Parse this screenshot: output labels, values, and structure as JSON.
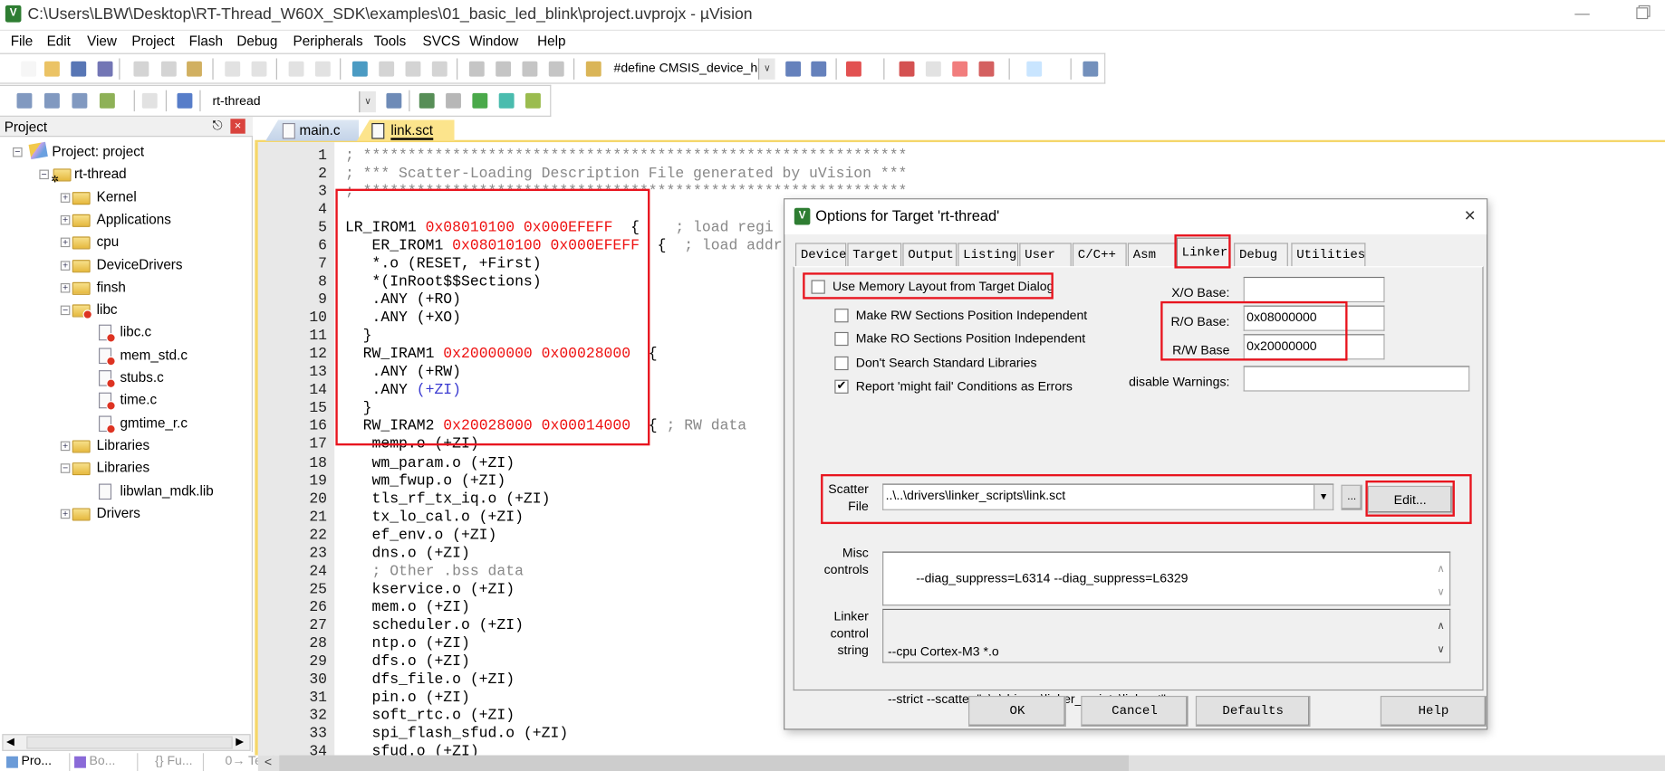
{
  "window": {
    "title": "C:\\Users\\LBW\\Desktop\\RT-Thread_W60X_SDK\\examples\\01_basic_led_blink\\project.uvprojx - µVision",
    "app_icon": "uvision-logo"
  },
  "menu": [
    "File",
    "Edit",
    "View",
    "Project",
    "Flash",
    "Debug",
    "Peripherals",
    "Tools",
    "SVCS",
    "Window",
    "Help"
  ],
  "toolbar": {
    "define_combo": "#define CMSIS_device_he",
    "target_combo": "rt-thread"
  },
  "project_panel": {
    "title": "Project",
    "tree": [
      {
        "label": "Project: project",
        "level": 0,
        "exp": "-",
        "icon": "project"
      },
      {
        "label": "rt-thread",
        "level": 1,
        "exp": "-",
        "icon": "target"
      },
      {
        "label": "Kernel",
        "level": 2,
        "exp": "+",
        "icon": "folder"
      },
      {
        "label": "Applications",
        "level": 2,
        "exp": "+",
        "icon": "folder"
      },
      {
        "label": "cpu",
        "level": 2,
        "exp": "+",
        "icon": "folder"
      },
      {
        "label": "DeviceDrivers",
        "level": 2,
        "exp": "+",
        "icon": "folder"
      },
      {
        "label": "finsh",
        "level": 2,
        "exp": "+",
        "icon": "folder"
      },
      {
        "label": "libc",
        "level": 2,
        "exp": "-",
        "icon": "folder-excluded"
      },
      {
        "label": "libc.c",
        "level": 3,
        "exp": "",
        "icon": "file-excluded"
      },
      {
        "label": "mem_std.c",
        "level": 3,
        "exp": "",
        "icon": "file-excluded"
      },
      {
        "label": "stubs.c",
        "level": 3,
        "exp": "",
        "icon": "file-excluded"
      },
      {
        "label": "time.c",
        "level": 3,
        "exp": "",
        "icon": "file-excluded"
      },
      {
        "label": "gmtime_r.c",
        "level": 3,
        "exp": "",
        "icon": "file-excluded"
      },
      {
        "label": "Libraries",
        "level": 2,
        "exp": "+",
        "icon": "folder"
      },
      {
        "label": "Libraries",
        "level": 2,
        "exp": "-",
        "icon": "folder-open"
      },
      {
        "label": "libwlan_mdk.lib",
        "level": 3,
        "exp": "",
        "icon": "file"
      },
      {
        "label": "Drivers",
        "level": 2,
        "exp": "+",
        "icon": "folder"
      }
    ],
    "bottom_tabs": [
      "Pro...",
      "Bo...",
      "{} Fu...",
      "0→ Te..."
    ]
  },
  "editor": {
    "tabs": [
      {
        "label": "main.c",
        "active": false
      },
      {
        "label": "link.sct",
        "active": true
      }
    ],
    "lines": [
      [
        [
          "; *************************************************************",
          "cmt"
        ]
      ],
      [
        [
          "; *** Scatter-Loading Description File generated by uVision ***",
          "cmt"
        ]
      ],
      [
        [
          "; *************************************************************",
          "cmt"
        ]
      ],
      [],
      [
        [
          "LR_IROM1 ",
          "code"
        ],
        [
          "0x08010100 0x000EFEFF",
          "hex"
        ],
        [
          "  {    ",
          "code"
        ],
        [
          "; load regi",
          "cmt"
        ]
      ],
      [
        [
          "   ER_IROM1 ",
          "code"
        ],
        [
          "0x08010100 0x000EFEFF",
          "hex"
        ],
        [
          "  {  ",
          "code"
        ],
        [
          "; load addr",
          "cmt"
        ]
      ],
      [
        [
          "   *.o (RESET, +First)",
          "code"
        ]
      ],
      [
        [
          "   *(InRoot$$Sections)",
          "code"
        ]
      ],
      [
        [
          "   .ANY (+RO)",
          "code"
        ]
      ],
      [
        [
          "   .ANY (+XO)",
          "code"
        ]
      ],
      [
        [
          "  }",
          "code"
        ]
      ],
      [
        [
          "  RW_IRAM1 ",
          "code"
        ],
        [
          "0x20000000 0x00028000",
          "hex"
        ],
        [
          "  {",
          "code"
        ]
      ],
      [
        [
          "   .ANY (+RW)",
          "code"
        ]
      ],
      [
        [
          "   .ANY ",
          "code"
        ],
        [
          "(+ZI)",
          "hl"
        ]
      ],
      [
        [
          "  }",
          "code"
        ]
      ],
      [
        [
          "  RW_IRAM2 ",
          "code"
        ],
        [
          "0x20028000 0x00014000",
          "hex"
        ],
        [
          "  { ",
          "code"
        ],
        [
          "; RW data",
          "cmt"
        ]
      ],
      [
        [
          "   memp.o (+ZI)",
          "code"
        ]
      ],
      [
        [
          "   wm_param.o (+ZI)",
          "code"
        ]
      ],
      [
        [
          "   wm_fwup.o (+ZI)",
          "code"
        ]
      ],
      [
        [
          "   tls_rf_tx_iq.o (+ZI)",
          "code"
        ]
      ],
      [
        [
          "   tx_lo_cal.o (+ZI)",
          "code"
        ]
      ],
      [
        [
          "   ef_env.o (+ZI)",
          "code"
        ]
      ],
      [
        [
          "   dns.o (+ZI)",
          "code"
        ]
      ],
      [
        [
          "   ; Other .bss data",
          "cmt"
        ]
      ],
      [
        [
          "   kservice.o (+ZI)",
          "code"
        ]
      ],
      [
        [
          "   mem.o (+ZI)",
          "code"
        ]
      ],
      [
        [
          "   scheduler.o (+ZI)",
          "code"
        ]
      ],
      [
        [
          "   ntp.o (+ZI)",
          "code"
        ]
      ],
      [
        [
          "   dfs.o (+ZI)",
          "code"
        ]
      ],
      [
        [
          "   dfs_file.o (+ZI)",
          "code"
        ]
      ],
      [
        [
          "   pin.o (+ZI)",
          "code"
        ]
      ],
      [
        [
          "   soft_rtc.o (+ZI)",
          "code"
        ]
      ],
      [
        [
          "   spi_flash_sfud.o (+ZI)",
          "code"
        ]
      ],
      [
        [
          "   sfud.o (+ZI)",
          "code"
        ]
      ]
    ]
  },
  "dialog": {
    "title": "Options for Target 'rt-thread'",
    "tabs": [
      "Device",
      "Target",
      "Output",
      "Listing",
      "User",
      "C/C++",
      "Asm",
      "Linker",
      "Debug",
      "Utilities"
    ],
    "active_tab": "Linker",
    "use_memory_layout": {
      "label": "Use Memory Layout from Target Dialog",
      "checked": false
    },
    "options": [
      {
        "label": "Make RW Sections Position Independent",
        "checked": false
      },
      {
        "label": "Make RO Sections Position Independent",
        "checked": false
      },
      {
        "label": "Don't Search Standard Libraries",
        "checked": false
      },
      {
        "label": "Report 'might fail' Conditions as Errors",
        "checked": true
      }
    ],
    "xo_base": {
      "label": "X/O Base:",
      "value": ""
    },
    "ro_base": {
      "label": "R/O Base:",
      "value": "0x08000000"
    },
    "rw_base": {
      "label": "R/W Base",
      "value": "0x20000000"
    },
    "disable_warnings": {
      "label": "disable Warnings:",
      "value": ""
    },
    "scatter": {
      "label1": "Scatter",
      "label2": "File",
      "value": "..\\..\\drivers\\linker_scripts\\link.sct",
      "browse": "...",
      "edit": "Edit..."
    },
    "misc": {
      "label1": "Misc",
      "label2": "controls",
      "value": "--diag_suppress=L6314 --diag_suppress=L6329"
    },
    "linker_string": {
      "label1": "Linker",
      "label2": "control",
      "label3": "string",
      "line1": "--cpu Cortex-M3 *.o",
      "line2": "--strict --scatter \"..\\..\\drivers\\linker_scripts\\link.sct\""
    },
    "buttons": {
      "ok": "OK",
      "cancel": "Cancel",
      "defaults": "Defaults",
      "help": "Help"
    }
  },
  "colors": {
    "annotation_red": "#e8141e",
    "hex_literal": "#ee1111",
    "comment": "#888888",
    "active_tab": "#fce48c"
  }
}
